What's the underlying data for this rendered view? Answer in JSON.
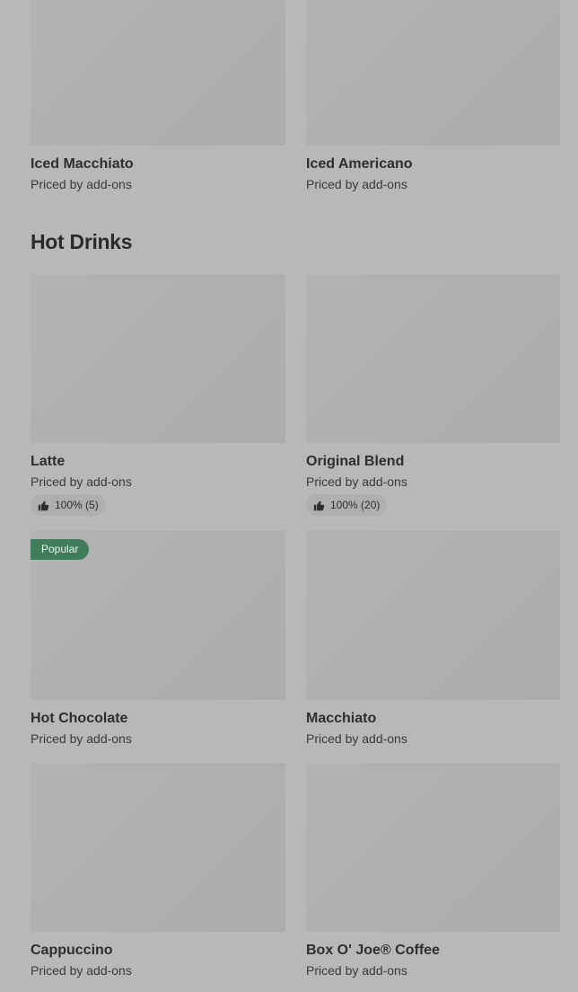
{
  "top_items": [
    {
      "name": "Iced Macchiato",
      "price": "Priced by add-ons"
    },
    {
      "name": "Iced Americano",
      "price": "Priced by add-ons"
    }
  ],
  "hot_drinks": {
    "title": "Hot Drinks",
    "items": [
      {
        "name": "Latte",
        "price": "Priced by add-ons",
        "rating": "100% (5)"
      },
      {
        "name": "Original Blend",
        "price": "Priced by add-ons",
        "rating": "100% (20)"
      },
      {
        "name": "Hot Chocolate",
        "price": "Priced by add-ons",
        "badge": "Popular"
      },
      {
        "name": "Macchiato",
        "price": "Priced by add-ons"
      },
      {
        "name": "Cappuccino",
        "price": "Priced by add-ons"
      },
      {
        "name": "Box O' Joe® Coffee",
        "price": "Priced by add-ons"
      }
    ]
  },
  "icons": {
    "rating": "thumbs-up-icon"
  },
  "colors": {
    "background": "#b8b8b8",
    "popular_badge": "#3f7d5b"
  }
}
